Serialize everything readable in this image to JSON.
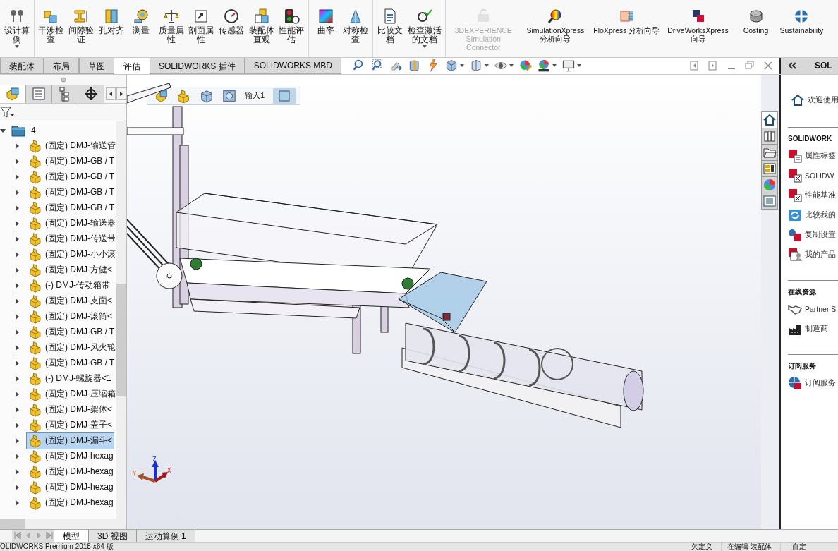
{
  "ribbon": {
    "groups": [
      {
        "kind": "tools",
        "tools": [
          {
            "label": "设计算例",
            "menu": true
          }
        ]
      },
      {
        "kind": "tools",
        "tools": [
          {
            "label": "干涉检查"
          },
          {
            "label": "间隙验证"
          },
          {
            "label": "孔对齐"
          },
          {
            "label": "测量"
          },
          {
            "label": "质量属性"
          },
          {
            "label": "剖面属性"
          },
          {
            "label": "传感器"
          },
          {
            "label": "装配体直观"
          },
          {
            "label": "性能评估"
          }
        ]
      },
      {
        "kind": "tools",
        "tools": [
          {
            "label": "曲率"
          },
          {
            "label": "对称检查"
          }
        ]
      },
      {
        "kind": "tools",
        "tools": [
          {
            "label": "比较文档"
          },
          {
            "label": "检查激活的文档",
            "menu": true
          }
        ]
      },
      {
        "kind": "addins",
        "tools": [
          {
            "label": "3DEXPERIENCE Simulation Connector",
            "disabled": true
          },
          {
            "label": "SimulationXpress 分析向导",
            "disabled": false
          },
          {
            "label": "FloXpress 分析向导",
            "disabled": false
          },
          {
            "label": "DriveWorksXpress 向导",
            "disabled": false
          },
          {
            "label": "Costing",
            "disabled": false
          },
          {
            "label": "Sustainability",
            "disabled": false
          }
        ]
      }
    ]
  },
  "tabs": [
    {
      "label": "装配体",
      "selected": false
    },
    {
      "label": "布局",
      "selected": false
    },
    {
      "label": "草图",
      "selected": false
    },
    {
      "label": "评估",
      "selected": true
    },
    {
      "label": "SOLIDWORKS 插件",
      "selected": false
    },
    {
      "label": "SOLIDWORKS MBD",
      "selected": false
    }
  ],
  "feature_manager": {
    "panel_tabs": [
      {
        "selected": true
      },
      {
        "selected": false
      },
      {
        "selected": false
      },
      {
        "selected": false
      }
    ],
    "tree": {
      "label": "4",
      "expanded": true,
      "children": [
        {
          "label": "(固定) DMJ-输送管",
          "expanded": false,
          "selected": false
        },
        {
          "label": "(固定) DMJ-GB / T",
          "expanded": false,
          "selected": false
        },
        {
          "label": "(固定) DMJ-GB / T",
          "expanded": false,
          "selected": false
        },
        {
          "label": "(固定) DMJ-GB / T",
          "expanded": false,
          "selected": false
        },
        {
          "label": "(固定) DMJ-GB / T",
          "expanded": false,
          "selected": false
        },
        {
          "label": "(固定) DMJ-输送器",
          "expanded": false,
          "selected": false
        },
        {
          "label": "(固定) DMJ-传送带",
          "expanded": false,
          "selected": false
        },
        {
          "label": "(固定) DMJ-小小滚",
          "expanded": false,
          "selected": false
        },
        {
          "label": "(固定) DMJ-方健<",
          "expanded": false,
          "selected": false
        },
        {
          "label": "(-) DMJ-传动箱带",
          "expanded": false,
          "selected": false
        },
        {
          "label": "(固定) DMJ-支面<",
          "expanded": false,
          "selected": false
        },
        {
          "label": "(固定) DMJ-滚筒<",
          "expanded": false,
          "selected": false
        },
        {
          "label": "(固定) DMJ-GB / T",
          "expanded": false,
          "selected": false
        },
        {
          "label": "(固定) DMJ-风火轮",
          "expanded": false,
          "selected": false
        },
        {
          "label": "(固定) DMJ-GB / T",
          "expanded": false,
          "selected": false
        },
        {
          "label": "(-) DMJ-螺旋器<1",
          "expanded": false,
          "selected": false
        },
        {
          "label": "(固定) DMJ-压缩箱",
          "expanded": false,
          "selected": false
        },
        {
          "label": "(固定) DMJ-架体<",
          "expanded": false,
          "selected": false
        },
        {
          "label": "(固定) DMJ-盖子<",
          "expanded": false,
          "selected": false
        },
        {
          "label": "(固定) DMJ-漏斗<",
          "expanded": false,
          "selected": true
        },
        {
          "label": "(固定) DMJ-hexag",
          "expanded": false,
          "selected": false
        },
        {
          "label": "(固定) DMJ-hexag",
          "expanded": false,
          "selected": false
        },
        {
          "label": "(固定) DMJ-hexag",
          "expanded": false,
          "selected": false
        },
        {
          "label": "(固定) DMJ-hexag",
          "expanded": false,
          "selected": false
        }
      ]
    }
  },
  "breadcrumb": {
    "label": "输入1"
  },
  "triad": {
    "x": "X",
    "y": "Y",
    "z": "Z"
  },
  "bottom_tabs": [
    {
      "label": "模型",
      "selected": true
    },
    {
      "label": "3D 视图",
      "selected": false
    },
    {
      "label": "运动算例 1",
      "selected": false
    }
  ],
  "task_pane": {
    "header": "SOL",
    "tabs": [
      {
        "selected": true
      },
      {
        "selected": false
      },
      {
        "selected": false
      },
      {
        "selected": false
      },
      {
        "selected": false
      },
      {
        "selected": false
      }
    ],
    "welcome": "欢迎使用",
    "sections": [
      {
        "title": "SOLIDWORK",
        "items": [
          "属性标签",
          "SOLIDW",
          "性能基准",
          "比较我的",
          "复制设置",
          "我的产品"
        ]
      },
      {
        "title": "在线资源",
        "items": [
          "Partner S",
          "制造商"
        ]
      },
      {
        "title": "订阅服务",
        "items": [
          "订阅服务"
        ]
      }
    ]
  },
  "status_bar": [
    "OLIDWORKS Premium 2018 x64 版",
    "欠定义",
    "在编辑 装配体",
    "自定"
  ]
}
